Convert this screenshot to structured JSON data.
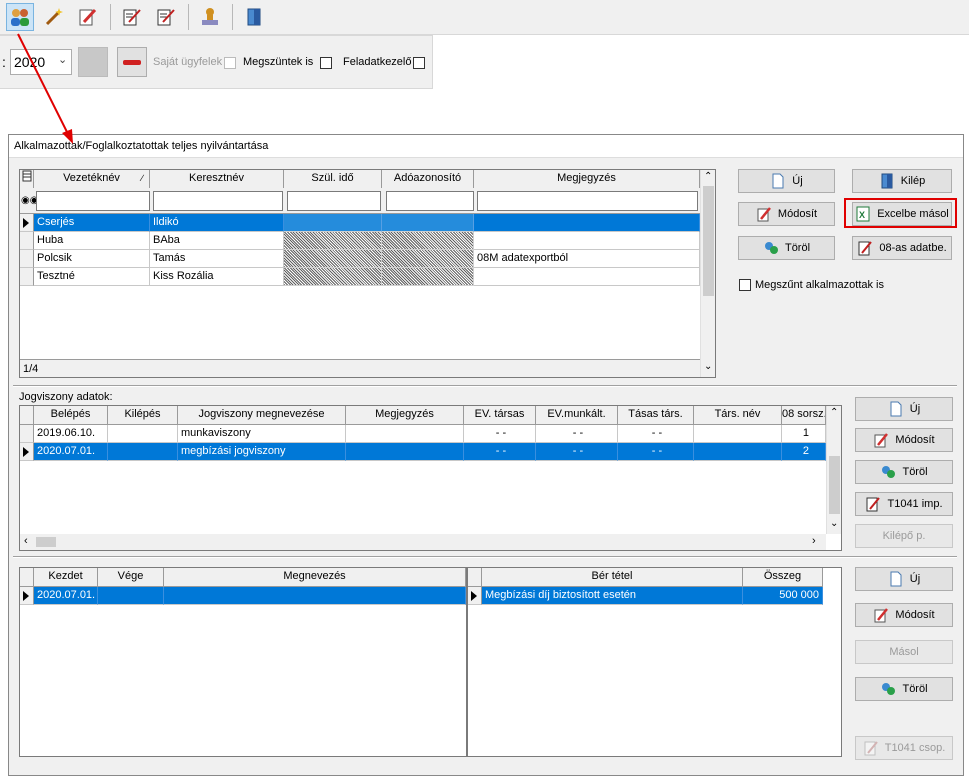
{
  "toolbar": {
    "icons": [
      "employees-icon",
      "wand-icon",
      "edit-icon",
      "report-icon",
      "report2-icon",
      "stamp-icon",
      "exit-door-icon"
    ]
  },
  "filter": {
    "year_prefix": ":",
    "year_value": "2020",
    "own_clients_label": "Saját ügyfelek",
    "closed_too_label": "Megszüntek is",
    "task_manager_label": "Feladatkezelő"
  },
  "window": {
    "title": "Alkalmazottak/Foglalkoztatottak teljes nyilvántartása"
  },
  "employees": {
    "headers": [
      "Vezetéknév",
      "Keresztnév",
      "Szül. idő",
      "Adóazonosító",
      "Megjegyzés"
    ],
    "rows": [
      {
        "last": "Cserjés",
        "first": "Ildikó",
        "note": "",
        "selected": true
      },
      {
        "last": "Huba",
        "first": "BAba",
        "note": "",
        "selected": false
      },
      {
        "last": "Polcsik",
        "first": "Tamás",
        "note": "08M adatexportból",
        "selected": false
      },
      {
        "last": "Tesztné",
        "first": "Kiss Rozália",
        "note": "",
        "selected": false
      }
    ],
    "counter": "1/4"
  },
  "employee_buttons": {
    "new": "Új",
    "exit": "Kilép",
    "modify": "Módosít",
    "excel": "Excelbe másol",
    "delete": "Töröl",
    "import08": "08-as adatbe.",
    "closed_employees": "Megszűnt alkalmazottak is"
  },
  "legal": {
    "section_label": "Jogviszony adatok:",
    "headers": [
      "Belépés",
      "Kilépés",
      "Jogviszony megnevezése",
      "Megjegyzés",
      "EV. társas",
      "EV.munkált.",
      "Tásas társ.",
      "Társ. név",
      "08 sorsz."
    ],
    "rows": [
      {
        "start": "2019.06.10.",
        "end": "",
        "type": "munkaviszony",
        "note": "",
        "ev_tarsas": "- -",
        "ev_munkalt": "- -",
        "tarsas_tars": "- -",
        "tars_nev": "",
        "sorsz": "1",
        "selected": false
      },
      {
        "start": "2020.07.01.",
        "end": "",
        "type": "megbízási jogviszony",
        "note": "",
        "ev_tarsas": "- -",
        "ev_munkalt": "- -",
        "tarsas_tars": "- -",
        "tars_nev": "",
        "sorsz": "2",
        "selected": true
      }
    ],
    "buttons": {
      "new": "Új",
      "modify": "Módosít",
      "delete": "Töröl",
      "t1041": "T1041 imp.",
      "exit_p": "Kilépő p."
    }
  },
  "periods": {
    "headers": [
      "Kezdet",
      "Vége",
      "Megnevezés"
    ],
    "rows": [
      {
        "start": "2020.07.01.",
        "end": "",
        "name": "",
        "selected": true
      }
    ]
  },
  "wages": {
    "headers": [
      "Bér tétel",
      "Összeg"
    ],
    "rows": [
      {
        "item": "Megbízási díj biztosított esetén",
        "amount": "500 000",
        "selected": true
      }
    ]
  },
  "bottom_buttons": {
    "new": "Új",
    "modify": "Módosít",
    "copy": "Másol",
    "delete": "Töröl",
    "t1041_group": "T1041 csop."
  },
  "colors": {
    "selection": "#0078d7",
    "highlight_red": "#e00000",
    "annotation_arrow": "#e00000"
  }
}
